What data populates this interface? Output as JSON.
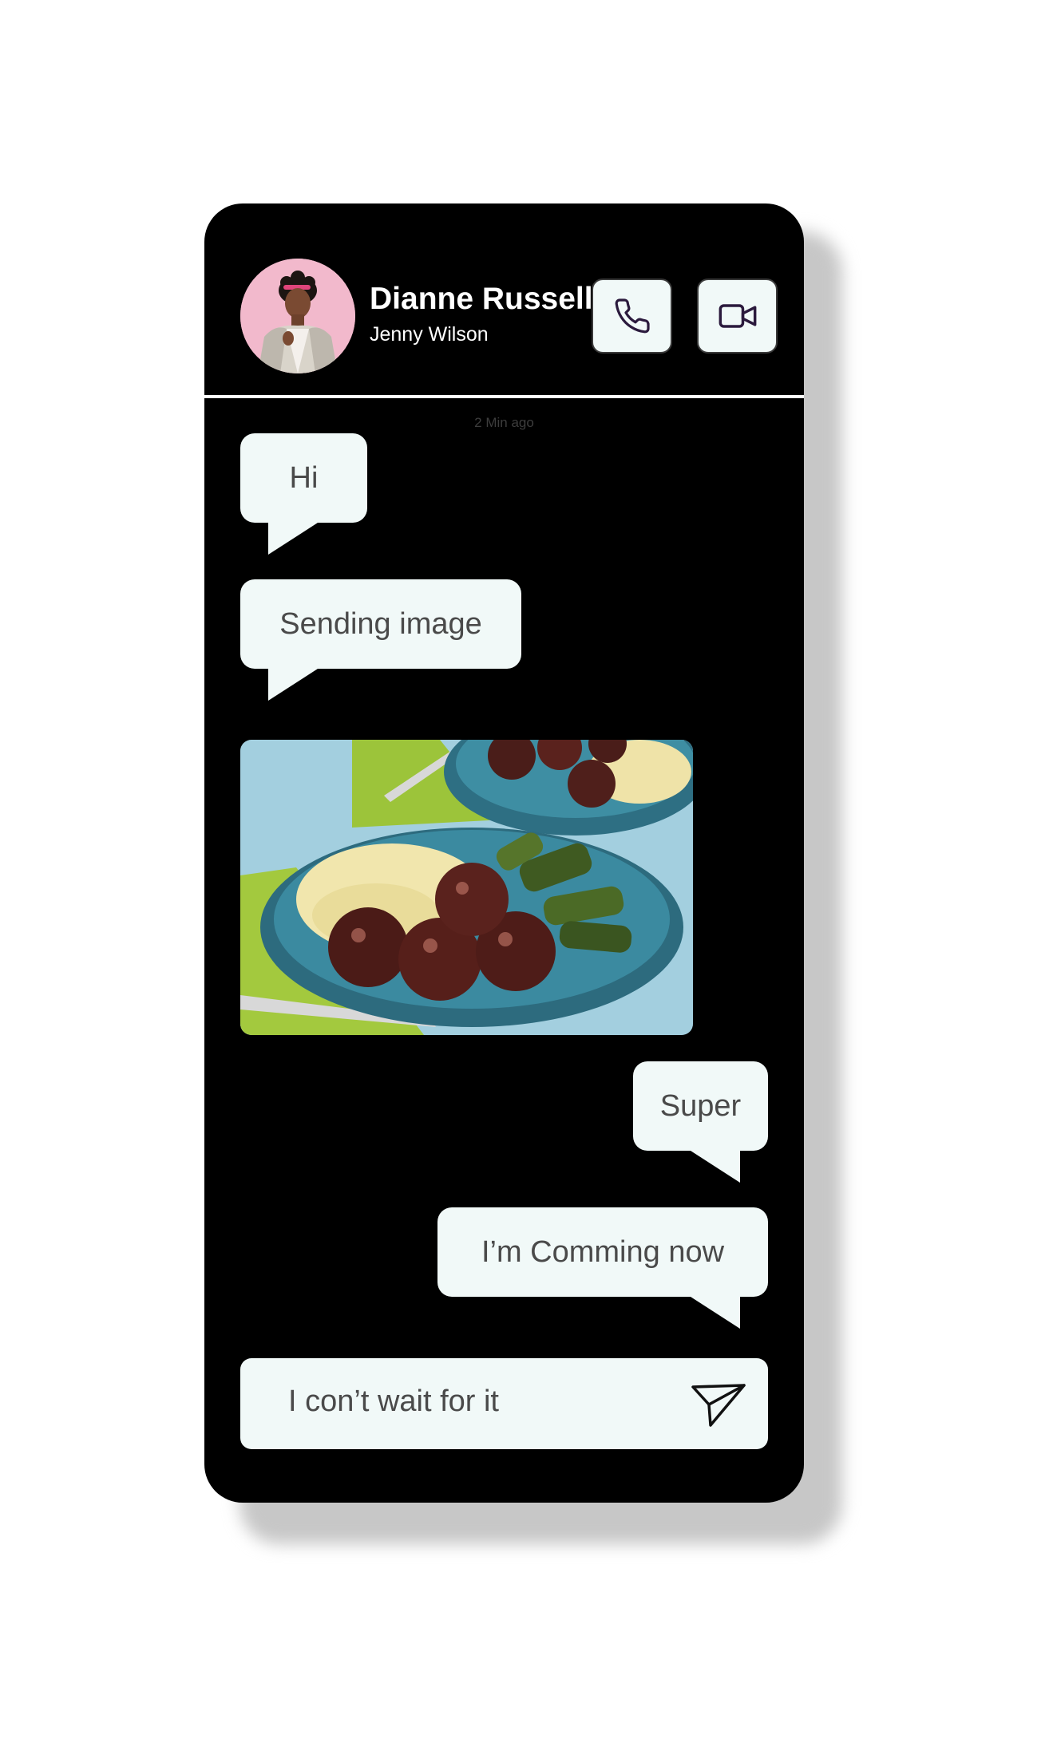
{
  "header": {
    "name": "Dianne Russell",
    "subtitle": "Jenny Wilson",
    "call_icon": "phone-icon",
    "video_icon": "video-camera-icon"
  },
  "chat": {
    "timestamp": "2 Min ago",
    "messages": [
      {
        "side": "received",
        "text": "Hi"
      },
      {
        "side": "received",
        "text": "Sending image"
      },
      {
        "side": "received",
        "type": "image",
        "image_subject": "meatballs with mashed potatoes and zucchini"
      },
      {
        "side": "sent",
        "text": "Super"
      },
      {
        "side": "sent",
        "text": "I’m Comming now"
      }
    ]
  },
  "composer": {
    "value": "I con’t wait for it",
    "send_icon": "send-icon"
  },
  "colors": {
    "phone_bg": "#000000",
    "bubble_bg": "#f1f9f8",
    "bubble_text": "#4a4a4a",
    "icon_stroke": "#2b1a3d"
  }
}
